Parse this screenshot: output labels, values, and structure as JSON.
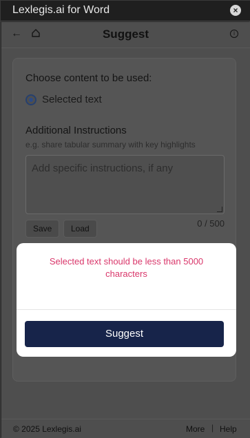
{
  "window": {
    "title": "Lexlegis.ai for Word",
    "close_icon": "close-icon"
  },
  "header": {
    "title": "Suggest",
    "back_icon": "arrow-left-icon",
    "home_icon": "home-icon",
    "info_icon": "info-icon"
  },
  "form": {
    "choose_label": "Choose content to be used:",
    "radio_option": "Selected text",
    "additional_label": "Additional Instructions",
    "hint": "e.g. share tabular summary with key highlights",
    "textarea_placeholder": "Add specific instructions, if any",
    "save_label": "Save",
    "load_label": "Load",
    "counter": "0 / 500"
  },
  "modal": {
    "message": "Selected text should be less than 5000 characters",
    "button_label": "Suggest"
  },
  "footer": {
    "copyright": "© 2025 Lexlegis.ai",
    "more": "More",
    "separator": "|",
    "help": "Help"
  },
  "colors": {
    "primary": "#17244a",
    "error": "#d9366a"
  }
}
